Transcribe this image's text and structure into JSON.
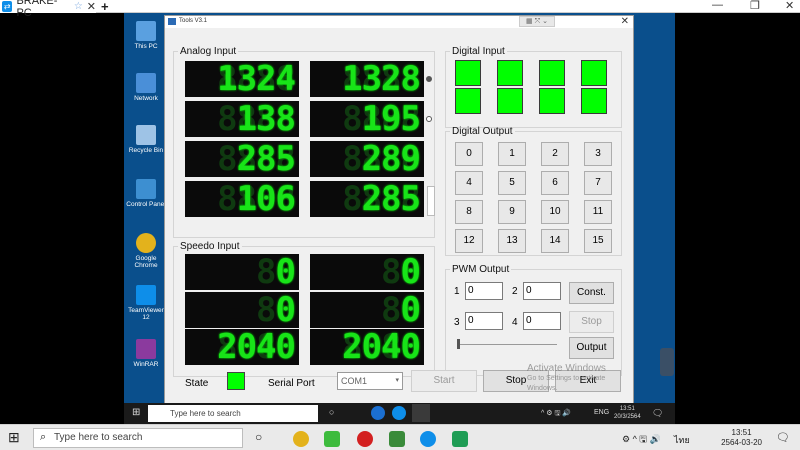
{
  "outer": {
    "tab_title": "BRAKE-PC",
    "tab_star": "☆",
    "tab_close": "✕",
    "new_tab": "+",
    "min": "—",
    "restore": "❐",
    "close": "✕"
  },
  "desktop_icons": [
    {
      "label": "This PC",
      "color": "#5aa0e0"
    },
    {
      "label": "Network",
      "color": "#4a8fd8"
    },
    {
      "label": "Recycle Bin",
      "color": "#9ec3e6"
    },
    {
      "label": "Control Panel",
      "color": "#3d8fd1"
    },
    {
      "label": "Google Chrome",
      "color": "#e3b21c"
    },
    {
      "label": "TeamViewer 12",
      "color": "#0e8ee9"
    },
    {
      "label": "WinRAR",
      "color": "#8b3a9e"
    }
  ],
  "tools": {
    "title": "Tools V3.1",
    "close": "✕",
    "analog_input": {
      "legend": "Analog Input",
      "values": [
        "1324",
        "1328",
        "138",
        "195",
        "285",
        "289",
        "106",
        "285"
      ]
    },
    "speedo_input": {
      "legend": "Speedo Input",
      "values": [
        "0",
        "0",
        "0",
        "0",
        "2040",
        "2040"
      ]
    },
    "digital_input": {
      "legend": "Digital Input",
      "led_color": "#00ff00"
    },
    "digital_output": {
      "legend": "Digital Output",
      "buttons": [
        "0",
        "1",
        "2",
        "3",
        "4",
        "5",
        "6",
        "7",
        "8",
        "9",
        "10",
        "11",
        "12",
        "13",
        "14",
        "15"
      ]
    },
    "pwm_output": {
      "legend": "PWM Output",
      "labels": [
        "1",
        "2",
        "3",
        "4"
      ],
      "values": [
        "0",
        "0",
        "0",
        "0"
      ],
      "const_label": "Const.",
      "stop_label": "Stop",
      "output_label": "Output"
    },
    "bottom": {
      "state_label": "State",
      "serial_label": "Serial Port",
      "port_value": "COM1",
      "start_label": "Start",
      "stop_label": "Stop",
      "exit_label": "Exit"
    },
    "watermark": {
      "line1": "Activate Windows",
      "line2": "Go to Settings to activate Windows."
    }
  },
  "remote_taskbar": {
    "search_placeholder": "Type here to search",
    "lang": "ENG",
    "time": "13:51",
    "date": "20/3/2564"
  },
  "taskbar": {
    "search_placeholder": "Type here to search",
    "lang": "ไทย",
    "time": "13:51",
    "date": "2564-03-20"
  }
}
